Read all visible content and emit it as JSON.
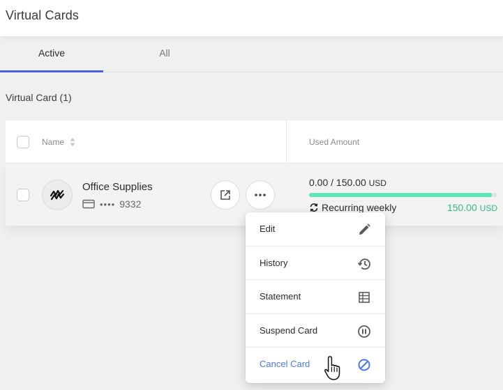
{
  "header": {
    "title": "Virtual Cards"
  },
  "tabs": [
    {
      "label": "Active",
      "active": true
    },
    {
      "label": "All",
      "active": false
    }
  ],
  "section": {
    "label": "Virtual Card (1)"
  },
  "table": {
    "columns": {
      "name": "Name",
      "used_amount": "Used Amount"
    },
    "rows": [
      {
        "name": "Office Supplies",
        "masked_number": "••••",
        "last4": "9332",
        "used": "0.00 / 150.00",
        "currency": "USD",
        "progress": 0.97,
        "recurring_label": "Recurring weekly",
        "recurring_amount": "150.00",
        "recurring_currency": "USD"
      }
    ]
  },
  "menu": {
    "items": [
      {
        "label": "Edit",
        "icon": "pencil-icon"
      },
      {
        "label": "History",
        "icon": "history-icon"
      },
      {
        "label": "Statement",
        "icon": "table-icon"
      },
      {
        "label": "Suspend Card",
        "icon": "pause-circle-icon"
      },
      {
        "label": "Cancel Card",
        "icon": "block-icon"
      }
    ]
  },
  "colors": {
    "accent": "#4b63e0",
    "progress": "#5be8b2",
    "positive": "#2dbd7c",
    "danger_link": "#4b78e6"
  }
}
